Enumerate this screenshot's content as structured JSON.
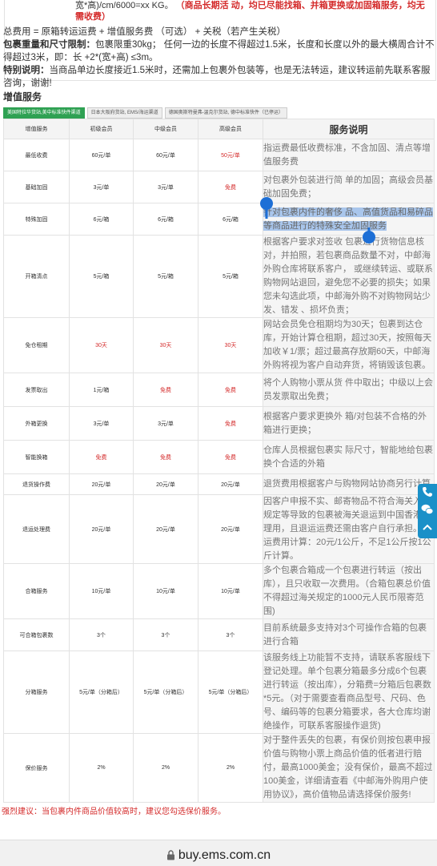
{
  "top": {
    "frag_text": "宽*高)/cm/6000=xx KG。",
    "frag_red": "（商品长期活 动，均已尽能找箱、并箱更换或加固箱服务，均无需收费）",
    "fee_line": "总费用 = 原箱转运运费 + 增值服务费 （可选） + 关税（若产生关税）",
    "weight_label": "包裹重量和尺寸限制：",
    "weight_text": "包裹限重30kg； 任何一边的长度不得超过1.5米，长度和长度以外的最大横周合计不得超过3米，即：长 +2*(宽+高) ≤3m。",
    "special_label": "特别说明：",
    "special_text": "当商品单边长度接近1.5米时，还需加上包裹外包装等，也是无法转运，建议转运前先联系客服咨询，谢谢!"
  },
  "section_title": "增值服务",
  "tabs": [
    "美国特拉华货站,美中标准快件渠道",
    "日本大阪府货站, EMS/海运渠道",
    "德国奥斯特曼弗-温克尔货站, 德中标准快件（已停运）"
  ],
  "table": {
    "headers": [
      "增值服务",
      "初级会员",
      "中级会员",
      "高级会员",
      "服务说明"
    ],
    "rows": [
      {
        "name": "最低收费",
        "v1": "60元/单",
        "v2": "60元/单",
        "v3": "50元/单",
        "red": [
          false,
          false,
          true
        ],
        "desc": "指运费最低收费标准，不含加固、清点等增值服务费"
      },
      {
        "name": "基础加固",
        "v1": "3元/单",
        "v2": "3元/单",
        "v3": "免费",
        "red": [
          false,
          false,
          true
        ],
        "desc": "对包裹外包装进行简 单的加固；高级会员基础加固免费；"
      },
      {
        "name": "特殊加固",
        "v1": "6元/箱",
        "v2": "6元/箱",
        "v3": "6元/箱",
        "red": [
          false,
          false,
          false
        ],
        "desc_hl": "针对包裹内件的奢侈 品、高值货品和易碎品等商品进行的特殊安全加固服务",
        "desc": ""
      },
      {
        "name": "开箱清点",
        "v1": "5元/箱",
        "v2": "5元/箱",
        "v3": "5元/箱",
        "red": [
          false,
          false,
          false
        ],
        "desc": "根据客户要求对签收 包裹进行货物信息核对，并拍照，若包裹商品数量不对，中邮海外购仓库将联系客户， 或继续转运、或联系购物网站退回，避免您不必要的损失；如果您未勾选此项，中邮海外购不对购物网站少发、错发 、损坏负责；"
      },
      {
        "name": "免仓租期",
        "v1": "30天",
        "v2": "30天",
        "v3": "30天",
        "red": [
          true,
          true,
          true
        ],
        "desc": "网站会员免仓租期均为30天；包裹到达仓库，开始计算仓租期，超过30天，按照每天加收￥1/票；超过最高存放期60天，中邮海外购将视为客户自动弃货，将销毁该包裹。"
      },
      {
        "name": "发票取出",
        "v1": "1元/箱",
        "v2": "免费",
        "v3": "免费",
        "red": [
          false,
          true,
          true
        ],
        "desc": "将个人购物小票从货 件中取出；中级以上会员发票取出免费；"
      },
      {
        "name": "外箱更换",
        "v1": "3元/单",
        "v2": "3元/单",
        "v3": "免费",
        "red": [
          false,
          false,
          true
        ],
        "desc": "根据客户要求更换外 箱/对包装不合格的外箱进行更换；"
      },
      {
        "name": "智能换箱",
        "v1": "免费",
        "v2": "免费",
        "v3": "免费",
        "red": [
          true,
          true,
          true
        ],
        "desc": "仓库人员根据包裹实 际尺寸，智能地给包裹换个合适的外箱"
      },
      {
        "name": "退货操作费",
        "v1": "20元/单",
        "v2": "20元/单",
        "v3": "20元/单",
        "red": [
          false,
          false,
          false
        ],
        "desc": "退货费用根据客户与购物网站协商另行计算"
      },
      {
        "name": "退运处理费",
        "v1": "20元/单",
        "v2": "20元/单",
        "v3": "20元/单",
        "red": [
          false,
          false,
          false
        ],
        "desc": "因客户申报不实、邮寄物品不符合海关入境规定等导致的包裹被海关退运到中国香港处理用，且退运运费还需由客户自行承担。退运费用计算：20元/1公斤，不足1公斤按1公斤计算。"
      },
      {
        "name": "合箱服务",
        "v1": "10元/单",
        "v2": "10元/单",
        "v3": "10元/单",
        "red": [
          false,
          false,
          false
        ],
        "desc": "多个包裹合箱成一个包裹进行转运（按出库），且只收取一次费用。（合箱包裹总价值不得超过海关规定的1000元人民币限寄范围)"
      },
      {
        "name": "可合箱包裹数",
        "v1": "3个",
        "v2": "3个",
        "v3": "3个",
        "red": [
          false,
          false,
          false
        ],
        "desc": "目前系统最多支持对3个可操作合箱的包裹进行合箱"
      },
      {
        "name": "分箱服务",
        "v1": "5元/单（分箱后）",
        "v2": "5元/单（分箱后）",
        "v3": "5元/单（分箱后）",
        "red": [
          false,
          false,
          false
        ],
        "desc": "该服务线上功能暂不支持，请联系客服线下登记处理。单个包裹分箱最多分成6个包裹进行转运（按出库），分箱费=分箱后包裹数*5元。（对于需要查看商品型号、尺码、色号、编码等的包裹分箱要求，各大仓库均谢绝操作，可联系客服操作退货)"
      },
      {
        "name": "保价服务",
        "v1": "2%",
        "v2": "2%",
        "v3": "2%",
        "red": [
          false,
          false,
          false
        ],
        "desc": "对于整件丢失的包裹，有保价则按包裹申报价值与购物小票上商品价值的低者进行赔付，最高1000美金；没有保价，最高不超过100美金，详细请查看《中邮海外购用户使用协议》，高价值物品请选择保价服务!"
      }
    ]
  },
  "warning": "强烈建议：当包裹内件商品价值较高时，建议您勾选保价服务。",
  "url": "buy.ems.com.cn",
  "colors": {
    "accent_green": "#2fa153",
    "red": "#d42b2b",
    "float_blue": "#1a90c8",
    "selection": "#a9c6ec"
  }
}
